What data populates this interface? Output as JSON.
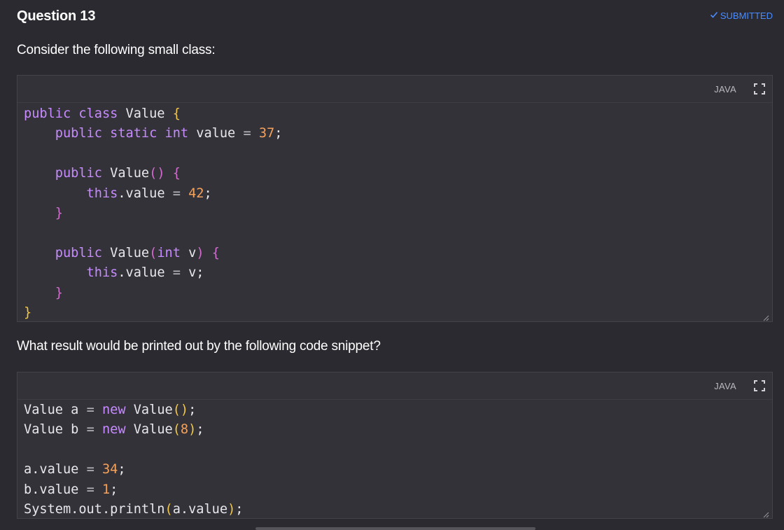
{
  "question": {
    "title": "Question 13",
    "status": "SUBMITTED",
    "status_icon": "check-icon"
  },
  "prompts": {
    "first": "Consider the following small class:",
    "second": "What result would be printed out by the following code snippet?"
  },
  "code_blocks": [
    {
      "language": "JAVA",
      "lines": [
        [
          {
            "t": "public class ",
            "c": "kw"
          },
          {
            "t": "Value ",
            "c": "plain"
          },
          {
            "t": "{",
            "c": "brace"
          }
        ],
        [
          {
            "t": "    public static int ",
            "c": "kw"
          },
          {
            "t": "value ",
            "c": "plain"
          },
          {
            "t": "= ",
            "c": "op"
          },
          {
            "t": "37",
            "c": "num"
          },
          {
            "t": ";",
            "c": "plain"
          }
        ],
        [],
        [
          {
            "t": "    public ",
            "c": "kw"
          },
          {
            "t": "Value",
            "c": "plain"
          },
          {
            "t": "() {",
            "c": "brace2"
          }
        ],
        [
          {
            "t": "        this",
            "c": "kw"
          },
          {
            "t": ".value ",
            "c": "plain"
          },
          {
            "t": "= ",
            "c": "op"
          },
          {
            "t": "42",
            "c": "num"
          },
          {
            "t": ";",
            "c": "plain"
          }
        ],
        [
          {
            "t": "    }",
            "c": "brace2"
          }
        ],
        [],
        [
          {
            "t": "    public ",
            "c": "kw"
          },
          {
            "t": "Value",
            "c": "plain"
          },
          {
            "t": "(",
            "c": "brace2"
          },
          {
            "t": "int ",
            "c": "kw"
          },
          {
            "t": "v",
            "c": "plain"
          },
          {
            "t": ") {",
            "c": "brace2"
          }
        ],
        [
          {
            "t": "        this",
            "c": "kw"
          },
          {
            "t": ".value ",
            "c": "plain"
          },
          {
            "t": "= ",
            "c": "op"
          },
          {
            "t": "v;",
            "c": "plain"
          }
        ],
        [
          {
            "t": "    }",
            "c": "brace2"
          }
        ],
        [
          {
            "t": "}",
            "c": "brace"
          }
        ]
      ]
    },
    {
      "language": "JAVA",
      "lines": [
        [
          {
            "t": "Value a ",
            "c": "plain"
          },
          {
            "t": "= ",
            "c": "op"
          },
          {
            "t": "new ",
            "c": "kw"
          },
          {
            "t": "Value",
            "c": "plain"
          },
          {
            "t": "()",
            "c": "brace"
          },
          {
            "t": ";",
            "c": "plain"
          }
        ],
        [
          {
            "t": "Value b ",
            "c": "plain"
          },
          {
            "t": "= ",
            "c": "op"
          },
          {
            "t": "new ",
            "c": "kw"
          },
          {
            "t": "Value",
            "c": "plain"
          },
          {
            "t": "(",
            "c": "brace"
          },
          {
            "t": "8",
            "c": "num"
          },
          {
            "t": ")",
            "c": "brace"
          },
          {
            "t": ";",
            "c": "plain"
          }
        ],
        [],
        [
          {
            "t": "a.value ",
            "c": "plain"
          },
          {
            "t": "= ",
            "c": "op"
          },
          {
            "t": "34",
            "c": "num"
          },
          {
            "t": ";",
            "c": "plain"
          }
        ],
        [
          {
            "t": "b.value ",
            "c": "plain"
          },
          {
            "t": "= ",
            "c": "op"
          },
          {
            "t": "1",
            "c": "num"
          },
          {
            "t": ";",
            "c": "plain"
          }
        ],
        [
          {
            "t": "System.out.println",
            "c": "plain"
          },
          {
            "t": "(",
            "c": "brace"
          },
          {
            "t": "a.value",
            "c": "plain"
          },
          {
            "t": ")",
            "c": "brace"
          },
          {
            "t": ";",
            "c": "plain"
          }
        ]
      ]
    }
  ],
  "icons": {
    "expand": "expand-icon",
    "resize": "resize-handle-icon"
  },
  "colors": {
    "background": "#2b2a30",
    "code_background": "#333238",
    "status_accent": "#4a8cff",
    "keyword": "#c78bff",
    "number": "#f5a25d"
  }
}
